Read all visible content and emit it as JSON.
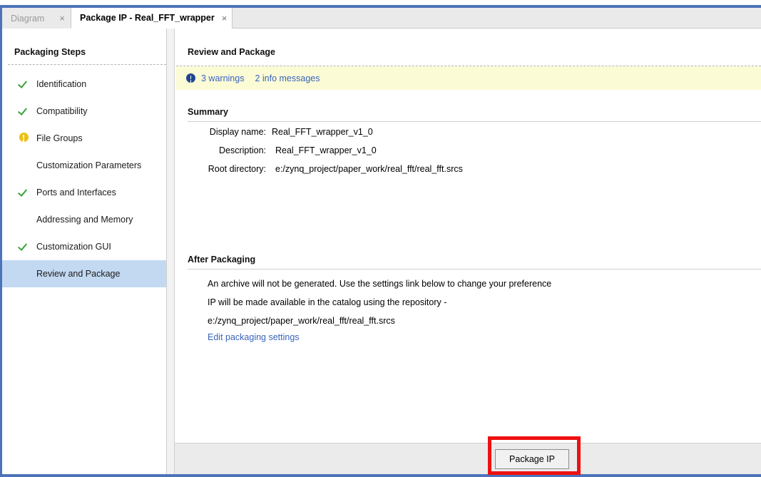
{
  "window": {
    "frame_color": "#4d73ba"
  },
  "tabs": [
    {
      "label": "Diagram",
      "close": "×",
      "active": false
    },
    {
      "label": "Package IP - Real_FFT_wrapper",
      "close": "×",
      "active": true
    }
  ],
  "sidebar": {
    "title": "Packaging Steps",
    "items": [
      {
        "label": "Identification",
        "icon": "check-icon",
        "state": "complete"
      },
      {
        "label": "Compatibility",
        "icon": "check-icon",
        "state": "complete"
      },
      {
        "label": "File Groups",
        "icon": "warning-icon",
        "state": "warning"
      },
      {
        "label": "Customization Parameters",
        "icon": "none",
        "state": "none"
      },
      {
        "label": "Ports and Interfaces",
        "icon": "check-icon",
        "state": "complete"
      },
      {
        "label": "Addressing and Memory",
        "icon": "none",
        "state": "none"
      },
      {
        "label": "Customization GUI",
        "icon": "check-icon",
        "state": "complete"
      },
      {
        "label": "Review and Package",
        "icon": "none",
        "state": "selected"
      }
    ],
    "selected_index": 7,
    "selected_bg": "#c3d9f2",
    "check_color": "#3aa23a",
    "warning_color": "#ecc012"
  },
  "main": {
    "header": "Review and Package",
    "banner": {
      "icon": "info-icon",
      "icon_color": "#20468c",
      "background": "#fbfbd6",
      "warnings_link": "3 warnings",
      "info_link": "2 info messages",
      "link_color": "#3a63bd"
    },
    "summary": {
      "title": "Summary",
      "fields": [
        {
          "label": "Display name:",
          "value": "Real_FFT_wrapper_v1_0"
        },
        {
          "label": "Description:",
          "value": "Real_FFT_wrapper_v1_0"
        },
        {
          "label": "Root directory:",
          "value": "e:/zynq_project/paper_work/real_fft/real_fft.srcs"
        }
      ]
    },
    "after_packaging": {
      "title": "After Packaging",
      "lines": [
        "An archive will not be generated. Use the settings link below to change your preference",
        "IP will be made available in the catalog using the repository -",
        "e:/zynq_project/paper_work/real_fft/real_fft.srcs"
      ],
      "link": "Edit packaging settings"
    }
  },
  "footer": {
    "package_button": "Package IP",
    "annotation_color": "#ee1111"
  }
}
